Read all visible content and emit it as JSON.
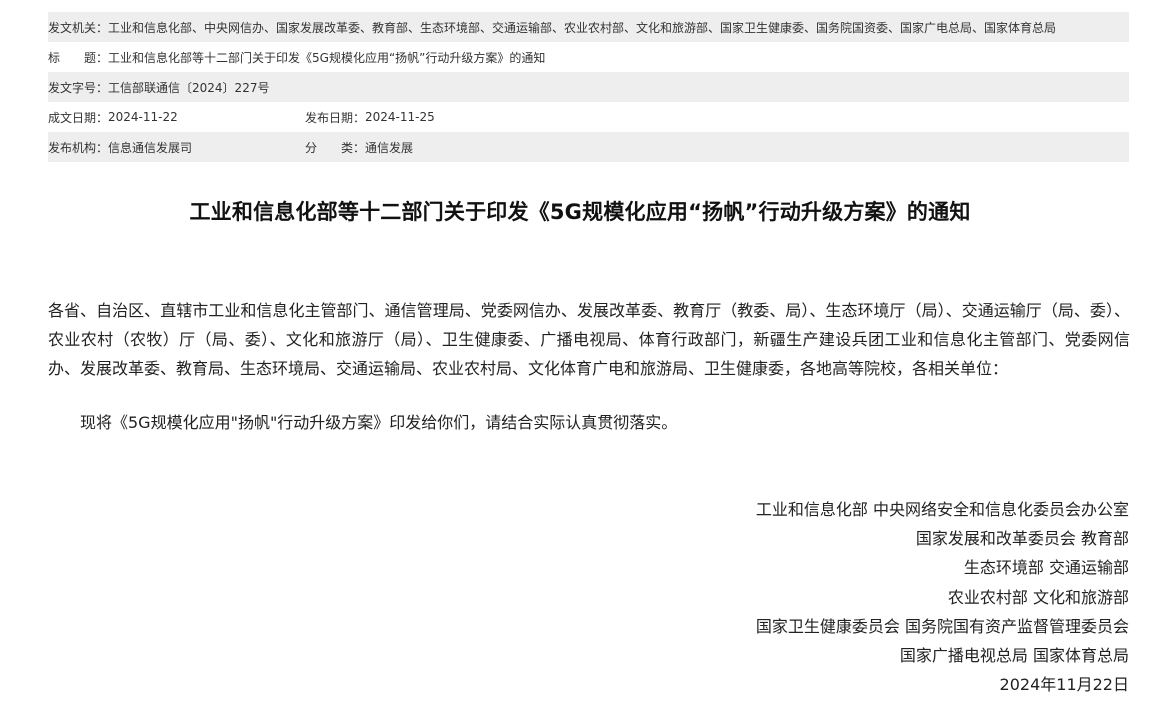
{
  "meta": {
    "issuer_label": "发文机关：",
    "issuer_value": "工业和信息化部、中央网信办、国家发展改革委、教育部、生态环境部、交通运输部、农业农村部、文化和旅游部、国家卫生健康委、国务院国资委、国家广电总局、国家体育总局",
    "title_label": "标　　题：",
    "title_value": "工业和信息化部等十二部门关于印发《5G规模化应用“扬帆”行动升级方案》的通知",
    "docno_label": "发文字号：",
    "docno_value": "工信部联通信〔2024〕227号",
    "created_label": "成文日期：",
    "created_value": "2024-11-22",
    "published_label": "发布日期：",
    "published_value": "2024-11-25",
    "org_label": "发布机构：",
    "org_value": "信息通信发展司",
    "category_label": "分　　类：",
    "category_value": "通信发展"
  },
  "document": {
    "title": "工业和信息化部等十二部门关于印发《5G规模化应用“扬帆”行动升级方案》的通知",
    "addressees": "各省、自治区、直辖市工业和信息化主管部门、通信管理局、党委网信办、发展改革委、教育厅（教委、局）、生态环境厅（局）、交通运输厅（局、委）、农业农村（农牧）厅（局、委）、文化和旅游厅（局）、卫生健康委、广播电视局、体育行政部门，新疆生产建设兵团工业和信息化主管部门、党委网信办、发展改革委、教育局、生态环境局、交通运输局、农业农村局、文化体育广电和旅游局、卫生健康委，各地高等院校，各相关单位：",
    "body": "现将《5G规模化应用\"扬帆\"行动升级方案》印发给你们，请结合实际认真贯彻落实。",
    "signers": [
      "工业和信息化部  中央网络安全和信息化委员会办公室",
      "国家发展和改革委员会 教育部",
      "生态环境部 交通运输部",
      "农业农村部 文化和旅游部",
      "国家卫生健康委员会 国务院国有资产监督管理委员会",
      "国家广播电视总局 国家体育总局"
    ],
    "date": "2024年11月22日"
  }
}
